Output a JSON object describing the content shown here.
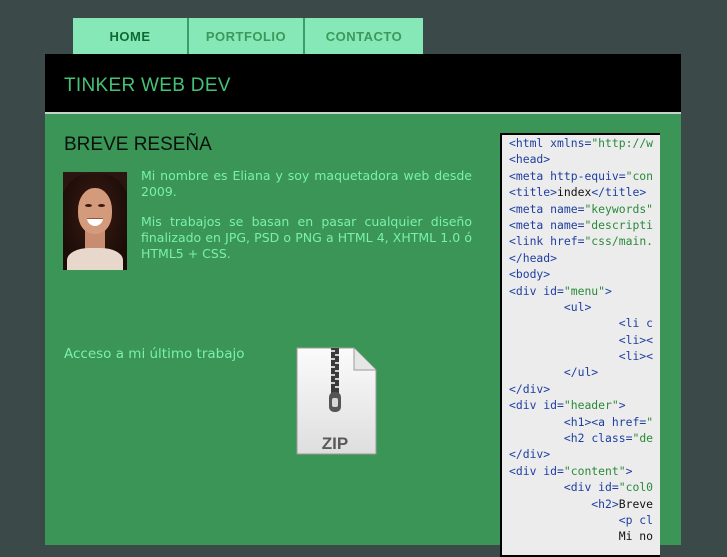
{
  "nav": {
    "items": [
      {
        "label": "HOME",
        "active": true
      },
      {
        "label": "PORTFOLIO",
        "active": false
      },
      {
        "label": "CONTACTO",
        "active": false
      }
    ]
  },
  "header": {
    "title": "TINKER WEB DEV"
  },
  "main": {
    "section_title": "BREVE RESEÑA",
    "bio": [
      "Mi nombre es Eliana y soy maquetadora web desde 2009.",
      "Mis trabajos se basan en pasar cualquier diseño finalizado en JPG, PSD o PNG a HTML 4, XHTML 1.0 ó HTML5 + CSS."
    ],
    "latest_work_link": "Acceso a mi último trabajo",
    "zip_label": "ZIP"
  },
  "code_panel": {
    "lines": [
      [
        {
          "t": "tag",
          "s": "<html "
        },
        {
          "t": "attr",
          "s": "xmlns="
        },
        {
          "t": "val",
          "s": "\"http://w"
        }
      ],
      [
        {
          "t": "tag",
          "s": "<head>"
        }
      ],
      [
        {
          "t": "tag",
          "s": "<meta "
        },
        {
          "t": "attr",
          "s": "http-equiv="
        },
        {
          "t": "val",
          "s": "\"con"
        }
      ],
      [
        {
          "t": "tag",
          "s": "<title>"
        },
        {
          "t": "txt",
          "s": "index"
        },
        {
          "t": "tag",
          "s": "</title>"
        }
      ],
      [
        {
          "t": "tag",
          "s": "<meta "
        },
        {
          "t": "attr",
          "s": "name="
        },
        {
          "t": "val",
          "s": "\"keywords\""
        }
      ],
      [
        {
          "t": "tag",
          "s": "<meta "
        },
        {
          "t": "attr",
          "s": "name="
        },
        {
          "t": "val",
          "s": "\"descripti"
        }
      ],
      [
        {
          "t": "tag",
          "s": "<link "
        },
        {
          "t": "attr",
          "s": "href="
        },
        {
          "t": "val",
          "s": "\"css/main."
        }
      ],
      [
        {
          "t": "tag",
          "s": "</head>"
        }
      ],
      [
        {
          "t": "tag",
          "s": "<body>"
        }
      ],
      [
        {
          "t": "tag",
          "s": "<div "
        },
        {
          "t": "attr",
          "s": "id="
        },
        {
          "t": "val",
          "s": "\"menu\""
        },
        {
          "t": "tag",
          "s": ">"
        }
      ],
      [
        {
          "t": "txt",
          "s": "        "
        },
        {
          "t": "tag",
          "s": "<ul>"
        }
      ],
      [
        {
          "t": "txt",
          "s": "                "
        },
        {
          "t": "tag",
          "s": "<li c"
        }
      ],
      [
        {
          "t": "txt",
          "s": "                "
        },
        {
          "t": "tag",
          "s": "<li><"
        }
      ],
      [
        {
          "t": "txt",
          "s": "                "
        },
        {
          "t": "tag",
          "s": "<li><"
        }
      ],
      [
        {
          "t": "txt",
          "s": "        "
        },
        {
          "t": "tag",
          "s": "</ul>"
        }
      ],
      [
        {
          "t": "tag",
          "s": "</div>"
        }
      ],
      [
        {
          "t": "tag",
          "s": "<div "
        },
        {
          "t": "attr",
          "s": "id="
        },
        {
          "t": "val",
          "s": "\"header\""
        },
        {
          "t": "tag",
          "s": ">"
        }
      ],
      [
        {
          "t": "txt",
          "s": "        "
        },
        {
          "t": "tag",
          "s": "<h1><a "
        },
        {
          "t": "attr",
          "s": "href="
        },
        {
          "t": "val",
          "s": "\""
        }
      ],
      [
        {
          "t": "txt",
          "s": "        "
        },
        {
          "t": "tag",
          "s": "<h2 "
        },
        {
          "t": "attr",
          "s": "class="
        },
        {
          "t": "val",
          "s": "\"de"
        }
      ],
      [
        {
          "t": "tag",
          "s": "</div>"
        }
      ],
      [
        {
          "t": "tag",
          "s": "<div "
        },
        {
          "t": "attr",
          "s": "id="
        },
        {
          "t": "val",
          "s": "\"content\""
        },
        {
          "t": "tag",
          "s": ">"
        }
      ],
      [
        {
          "t": "txt",
          "s": "        "
        },
        {
          "t": "tag",
          "s": "<div "
        },
        {
          "t": "attr",
          "s": "id="
        },
        {
          "t": "val",
          "s": "\"col0"
        }
      ],
      [
        {
          "t": "txt",
          "s": "            "
        },
        {
          "t": "tag",
          "s": "<h2>"
        },
        {
          "t": "txt",
          "s": "Breve"
        }
      ],
      [
        {
          "t": "txt",
          "s": "                "
        },
        {
          "t": "tag",
          "s": "<p cl"
        }
      ],
      [
        {
          "t": "txt",
          "s": "                Mi no"
        }
      ]
    ]
  }
}
